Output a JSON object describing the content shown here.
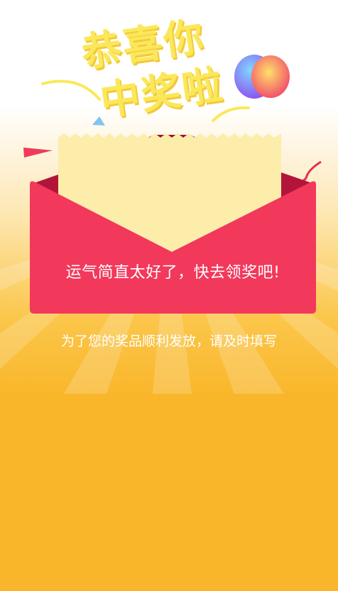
{
  "headline": {
    "line1": "恭喜你",
    "line2": "中奖啦"
  },
  "envelope": {
    "message": "运气简直太好了，快去领奖吧!"
  },
  "subtitle": "为了您的奖品顺利发放，请及时填写",
  "colors": {
    "background_top": "#ffffff",
    "background_bottom": "#f9b62a",
    "envelope_red": "#f2385b",
    "letter_paper": "#fcedaa",
    "headline_yellow": "#fbe85a"
  }
}
